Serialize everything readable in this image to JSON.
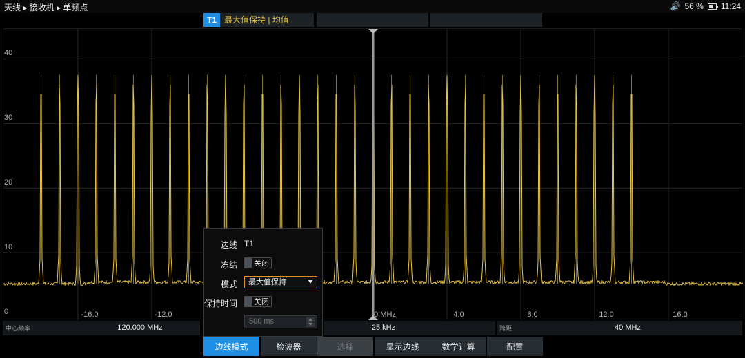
{
  "breadcrumb": "天线 ▸ 接收机 ▸ 单频点",
  "status": {
    "volume_icon": "speaker-icon",
    "battery": "56 %",
    "battery_level": 0.56,
    "time": "11:24"
  },
  "trace_bar": {
    "tag": "T1",
    "mode_text": "最大值保持 | 均值"
  },
  "chart_data": {
    "type": "line",
    "series": [
      {
        "color": "#e6c347",
        "peak_x_mhz": [
          -18.0,
          -17.0,
          -16.0,
          -15.0,
          -14.0,
          -13.0,
          -12.0,
          -11.0,
          -10.0,
          -9.0,
          -8.0,
          -7.0,
          -6.0,
          -5.0,
          -4.0,
          -3.0,
          -2.0,
          -1.0,
          0.0,
          1.0,
          2.0,
          3.0,
          4.0,
          5.0,
          6.0,
          7.0,
          8.0,
          9.0,
          10.0,
          11.0,
          12.0,
          13.0,
          14.0
        ],
        "peak_y": 37.5,
        "floor_y": 5.2
      }
    ],
    "y_ticks": [
      "40",
      "30",
      "20",
      "10",
      "0"
    ],
    "x_ticks": [
      "-16.0",
      "-12.0",
      "0 MHz",
      "4.0",
      "8.0",
      "12.0",
      "16.0"
    ],
    "x_tick_values": [
      -16,
      -12,
      0,
      4,
      8,
      12,
      16
    ],
    "ylim": [
      0,
      42
    ],
    "xlim": [
      -20,
      20
    ],
    "marker_x": 0,
    "grid": true
  },
  "infobar": {
    "center_label": "中心频率",
    "center_value": "120.000 MHz",
    "mid_value": "25 kHz",
    "span_label": "跨距",
    "span_value": "40 MHz"
  },
  "panel": {
    "trace_label": "边线",
    "trace_value": "T1",
    "freeze_label": "冻结",
    "freeze_value": "关闭",
    "mode_label": "模式",
    "mode_value": "最大值保持",
    "hold_label": "保持时间",
    "hold_value": "关闭",
    "hold_time_value": "500 ms"
  },
  "softkeys": [
    "边线模式",
    "检波器",
    "选择",
    "显示边线",
    "数学计算",
    "配置"
  ]
}
